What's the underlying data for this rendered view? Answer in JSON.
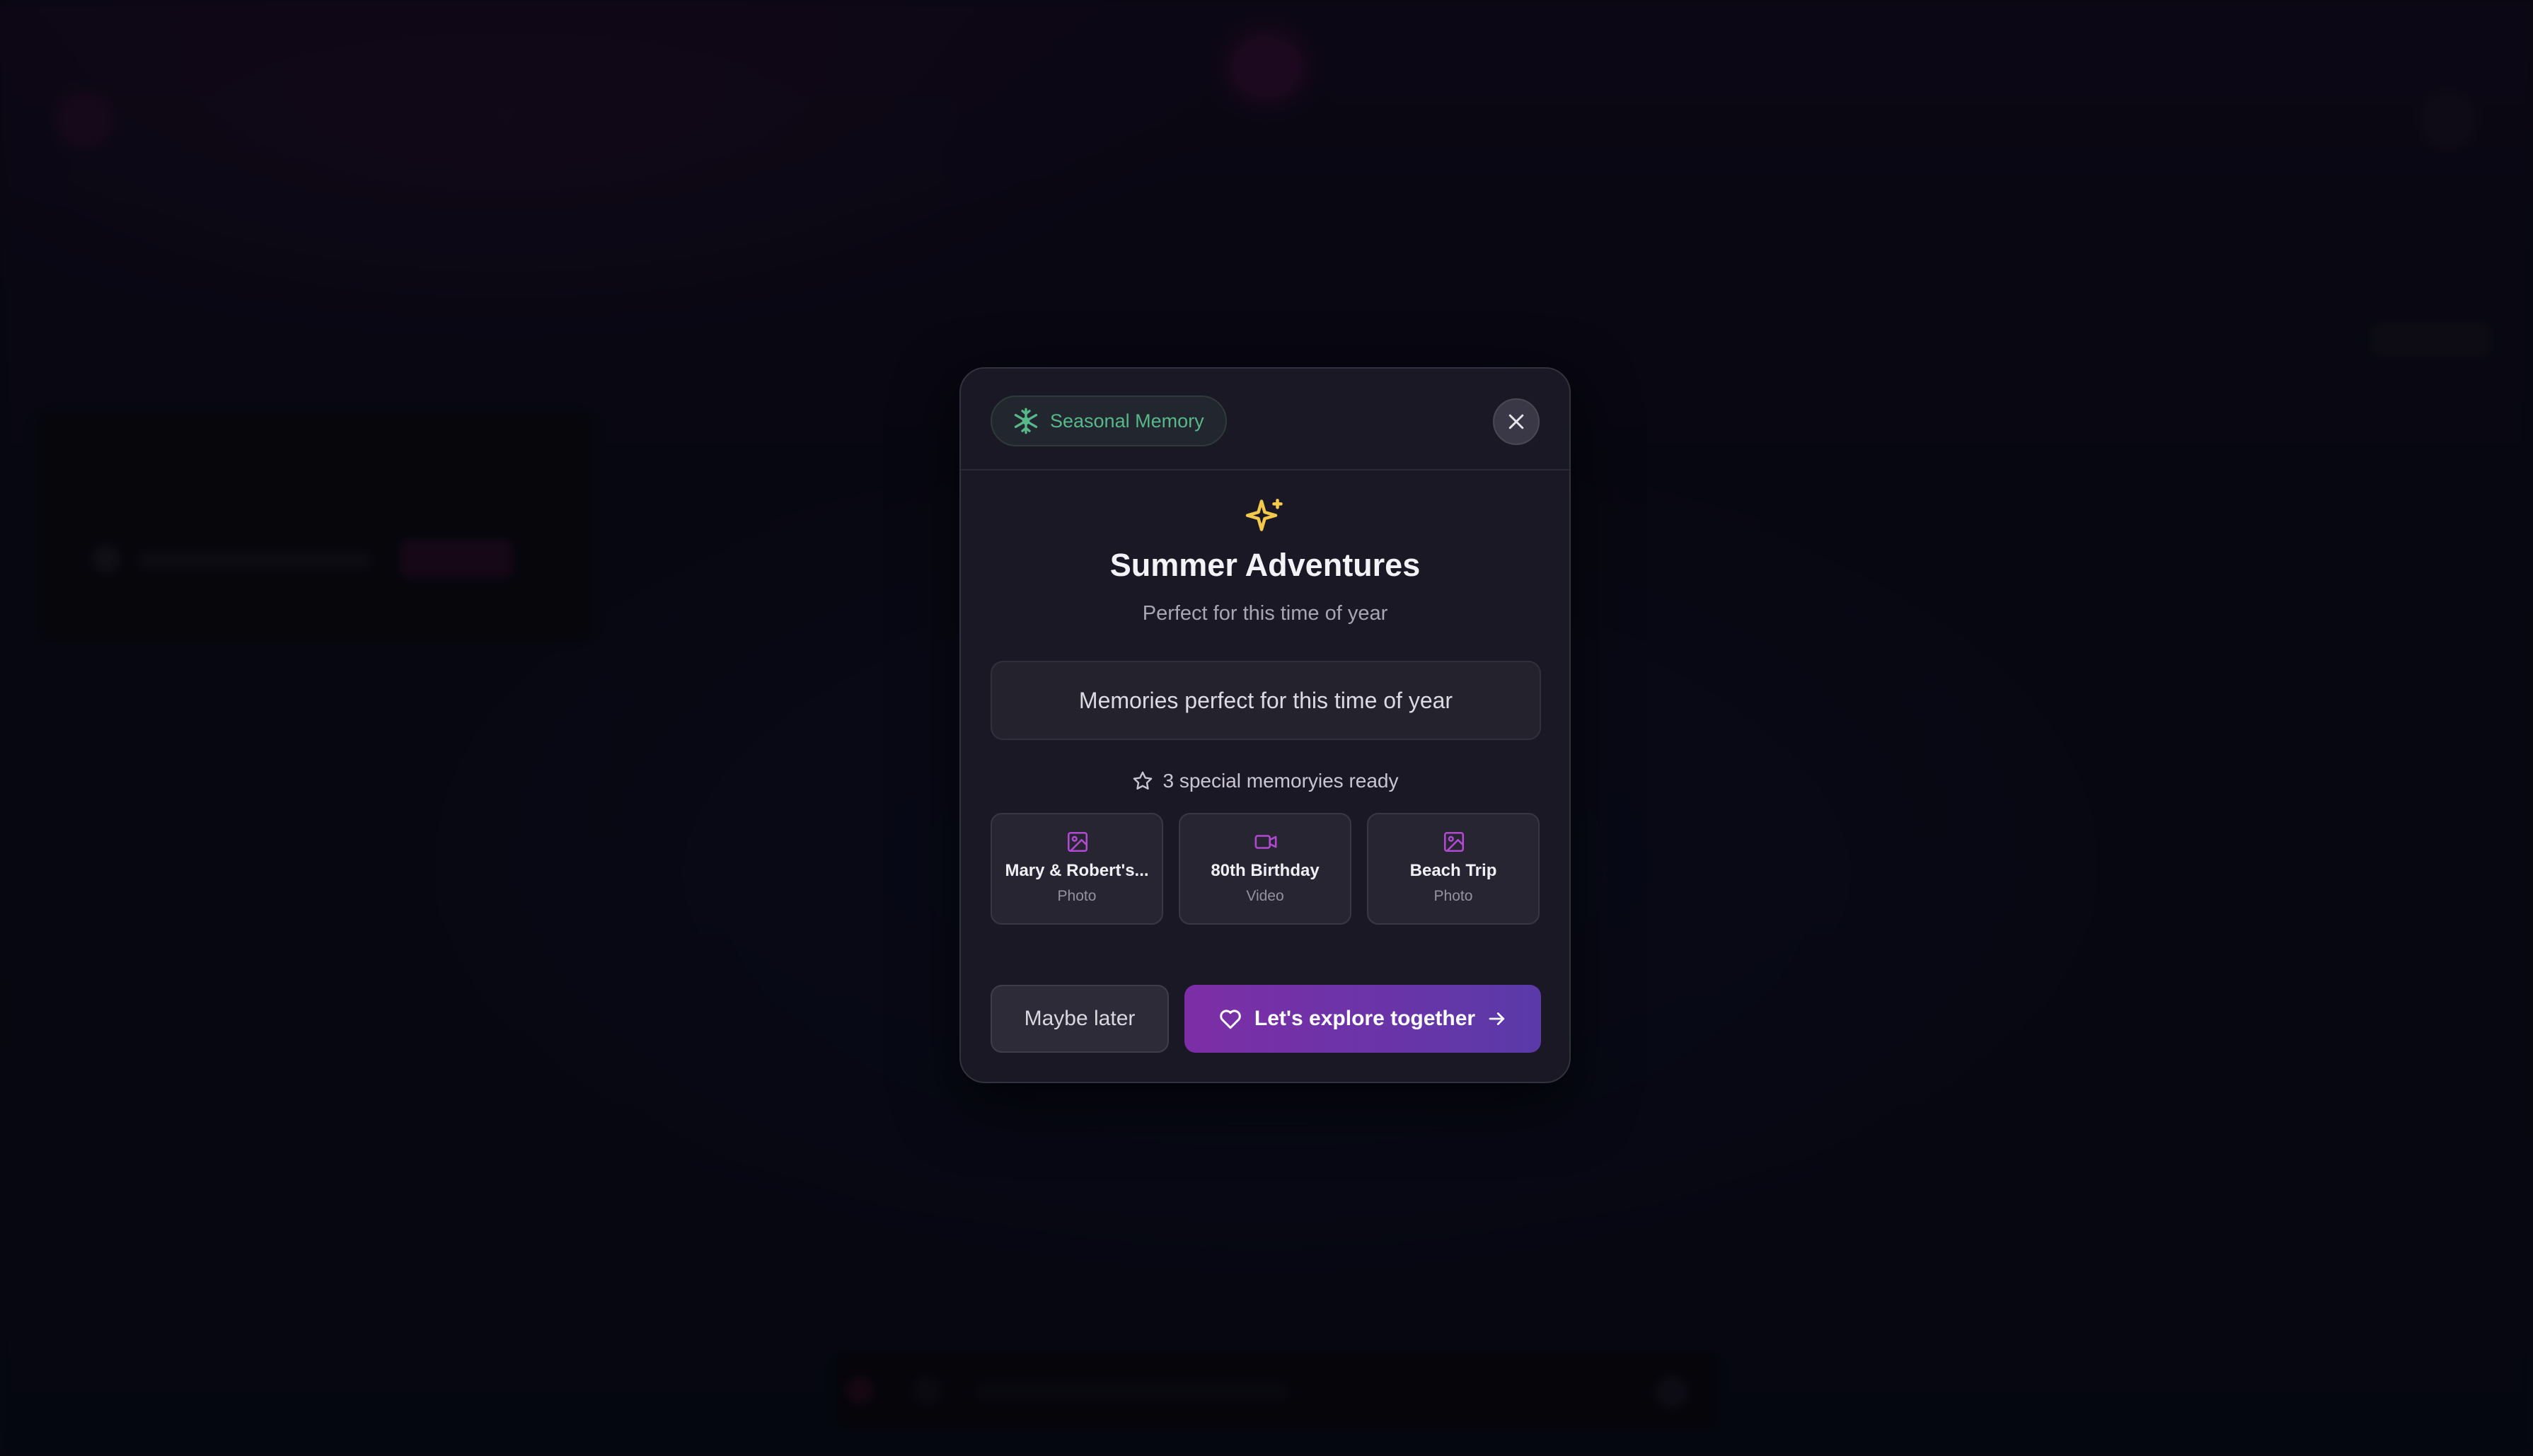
{
  "modal": {
    "badge_label": "Seasonal Memory",
    "title": "Summer Adventures",
    "subtitle": "Perfect for this time of year",
    "description": "Memories perfect for this time of year",
    "count_text": "3 special memoryies ready",
    "memories": [
      {
        "title": "Mary & Robert's...",
        "type": "Photo",
        "icon": "image-icon"
      },
      {
        "title": "80th Birthday",
        "type": "Video",
        "icon": "video-icon"
      },
      {
        "title": "Beach Trip",
        "type": "Photo",
        "icon": "image-icon"
      }
    ],
    "secondary_button": "Maybe later",
    "primary_button": "Let's explore together"
  },
  "colors": {
    "badge_text": "#58b889",
    "accent_purple": "#7d2ea6",
    "sparkle": "#f2c94c",
    "media_icon": "#b04ad0"
  }
}
